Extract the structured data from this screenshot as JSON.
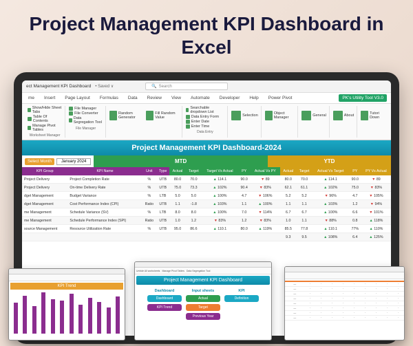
{
  "hero": {
    "title": "Project Management KPI Dashboard in Excel"
  },
  "titlebar": {
    "doc": "ect Management KPI Dashboard",
    "status": "• Saved ∨",
    "search_placeholder": "Search"
  },
  "ribbon_tabs": [
    "me",
    "Insert",
    "Page Layout",
    "Formulas",
    "Data",
    "Review",
    "View",
    "Automate",
    "Developer",
    "Help",
    "Power Pivot"
  ],
  "ribbon_util": "PK's Utility Tool V3.0",
  "ribbon_groups": [
    {
      "label": "Worksheet Manager",
      "items": [
        "Show/Hide Sheet Tabs",
        "Table Of Contents",
        "Manage Pivot Tables"
      ]
    },
    {
      "label": "File Manager",
      "items": [
        "File Manager",
        "File Converter",
        "Data Segregation Tool"
      ]
    },
    {
      "label": "",
      "items": [
        "Random Generator",
        "Fill Random Value"
      ],
      "h": true
    },
    {
      "label": "Data Entry",
      "items": [
        "Searchable dropdown List",
        "Data Entry Form",
        "Enter Date",
        "Enter Time"
      ]
    },
    {
      "label": "",
      "items": [
        "Selection"
      ],
      "h": true
    },
    {
      "label": "",
      "items": [
        "Object Manager"
      ],
      "h": true
    },
    {
      "label": "",
      "items": [
        "General"
      ],
      "h": true
    },
    {
      "label": "",
      "items": [
        "About"
      ],
      "h": true
    },
    {
      "label": "",
      "items": [
        "Tutori Down"
      ],
      "h": true
    }
  ],
  "dash": {
    "title": "Project Management KPI Dashboard-2024",
    "select_label": "Select Month",
    "month": "January 2024",
    "mtd": "MTD",
    "ytd": "YTD",
    "cols_main": [
      "KPI Group",
      "KPI Name",
      "Unit",
      "Type"
    ],
    "cols_mtd": [
      "Actual",
      "Target",
      "Target Vs Actual",
      "PY",
      "Actual Vs PY"
    ],
    "cols_ytd": [
      "Actual",
      "Target",
      "Actual Vs Target",
      "PY",
      "PY Vs Actual"
    ],
    "rows": [
      {
        "g": "Project Delivery",
        "n": "Project Completion Rate",
        "u": "%",
        "t": "UTB",
        "a": "80.0",
        "tg": "70.0",
        "tva": "114.1",
        "tvd": "u",
        "py": "90.0",
        "avp": "89",
        "avd": "d",
        "ya": "80.0",
        "yt": "70.0",
        "yv": "114.1",
        "yvd": "u",
        "ypy": "90.0",
        "ypv": "89",
        "ypd": "d"
      },
      {
        "g": "Project Delivery",
        "n": "On-time Delivery Rate",
        "u": "%",
        "t": "UTB",
        "a": "75.0",
        "tg": "73.3",
        "tva": "102%",
        "tvd": "u",
        "py": "90.4",
        "avp": "83%",
        "avd": "d",
        "ya": "62.1",
        "yt": "61.1",
        "yv": "102%",
        "yvd": "u",
        "ypy": "75.0",
        "ypv": "83%",
        "ypd": "d"
      },
      {
        "g": "dget Management",
        "n": "Budget Variance",
        "u": "%",
        "t": "LTB",
        "a": "5.0",
        "tg": "5.0",
        "tva": "100%",
        "tvd": "u",
        "py": "4.7",
        "avp": "106%",
        "avd": "d",
        "ya": "5.2",
        "yt": "5.2",
        "yv": "96%",
        "yvd": "d",
        "ypy": "4.7",
        "ypv": "105%",
        "ypd": "d"
      },
      {
        "g": "dget Management",
        "n": "Cost Performance Index (CPI)",
        "u": "Ratio",
        "t": "UTB",
        "a": "1.1",
        "tg": "-1.8",
        "tva": "103%",
        "tvd": "u",
        "py": "1.1",
        "avp": "100%",
        "avd": "u",
        "ya": "1.1",
        "yt": "1.1",
        "yv": "103%",
        "yvd": "u",
        "ypy": "1.2",
        "ypv": "94%",
        "ypd": "d"
      },
      {
        "g": "me Management",
        "n": "Schedule Variance (SV)",
        "u": "%",
        "t": "LTB",
        "a": "8.0",
        "tg": "8.0",
        "tva": "100%",
        "tvd": "u",
        "py": "7.0",
        "avp": "114%",
        "avd": "d",
        "ya": "6.7",
        "yt": "6.7",
        "yv": "100%",
        "yvd": "u",
        "ypy": "6.6",
        "ypv": "101%",
        "ypd": "d"
      },
      {
        "g": "me Management",
        "n": "Schedule Performance Index (SPI)",
        "u": "Ratio",
        "t": "UTB",
        "a": "1.0",
        "tg": "1.2",
        "tva": "83%",
        "tvd": "d",
        "py": "1.2",
        "avp": "83%",
        "avd": "d",
        "ya": "1.0",
        "yt": "1.1",
        "yv": "88%",
        "yvd": "d",
        "ypy": "0.8",
        "ypv": "118%",
        "ypd": "u"
      },
      {
        "g": "source Management",
        "n": "Resource Utilization Rate",
        "u": "%",
        "t": "UTB",
        "a": "95.0",
        "tg": "86.6",
        "tva": "110.1",
        "tvd": "u",
        "py": "80.0",
        "avp": "119%",
        "avd": "u",
        "ya": "85.5",
        "yt": "77.8",
        "yv": "110.1",
        "yvd": "u",
        "ypy": "77%",
        "ypv": "110%",
        "ypd": "u"
      },
      {
        "g": "",
        "n": "",
        "u": "",
        "t": "",
        "a": "",
        "tg": "",
        "tva": "",
        "tvd": "",
        "py": "",
        "avp": "",
        "avd": "",
        "ya": "9.3",
        "yt": "9.5",
        "yv": "108%",
        "yvd": "u",
        "ypy": "6.4",
        "ypv": "125%",
        "ypd": "u"
      }
    ]
  },
  "mini1": {
    "title": "KPI Trend",
    "bars": [
      45,
      55,
      40,
      60,
      50,
      48,
      58,
      42,
      52,
      46,
      38,
      54
    ]
  },
  "mini2": {
    "title": "Project Management KPI Dashboard",
    "rib": [
      "Unhide All worksheets",
      "Manage Pivot Tables",
      "Data Segregation Tool"
    ],
    "col1_h": "Dashboard",
    "col1": [
      "Dashboard",
      "KPI Trend"
    ],
    "col2_h": "Input sheets",
    "col2": [
      "Actual",
      "Target",
      "Previous Year"
    ],
    "col3_h": "KPI",
    "col3": [
      "Definition"
    ]
  },
  "mini3": {
    "title": "",
    "rows": 8
  }
}
